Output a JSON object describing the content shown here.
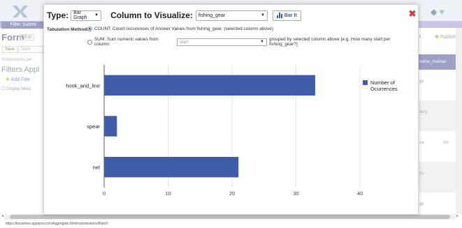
{
  "background": {
    "filter_submissions_label": "Filter Submi",
    "form_label": "Form",
    "share_label": "Shar",
    "save_label": "Save",
    "save2_label": "Save",
    "submissions_per_label": "Submissions per",
    "filters_label": "Filters Appl",
    "add_filter_label": "Add Filte",
    "display_metadata_label": "Display Meta",
    "publish_label": "Publish",
    "publish_prefix": "t",
    "column_header": "name_manual",
    "row_values": [
      "ge",
      "racy",
      "ca",
      "ris",
      "ge"
    ],
    "row_value_extra": "An",
    "status_url": "https://korastree.appspot.com/Aggregate.html#submissions/filter///"
  },
  "dialog": {
    "type_label": "Type:",
    "type_value": "Bar Graph",
    "column_label": "Column to Visualize:",
    "column_value": "fishing_gear",
    "bar_it_label": "Bar It",
    "close_icon": "close-icon",
    "tabulation_label": "Tabulation Method:",
    "count_option": "COUNT: Count occurences of Answer Values from fishing_gear. (selected column above)",
    "sum_prefix": "SUM: Sum numeric values from column:",
    "sum_column_value": "start",
    "sum_suffix": "grouped by selected column above [e.g. How many start per fishing_gear?]"
  },
  "chart_data": {
    "type": "bar",
    "orientation": "horizontal",
    "categories": [
      "hook_and_line",
      "spear",
      "net"
    ],
    "series": [
      {
        "name": "Number of Ocurrences",
        "values": [
          33,
          2,
          21
        ],
        "color": "#3f5ca9"
      }
    ],
    "xlim": [
      0,
      40
    ],
    "xticks": [
      0,
      10,
      20,
      30,
      40
    ],
    "grid": true,
    "legend_position": "right"
  }
}
